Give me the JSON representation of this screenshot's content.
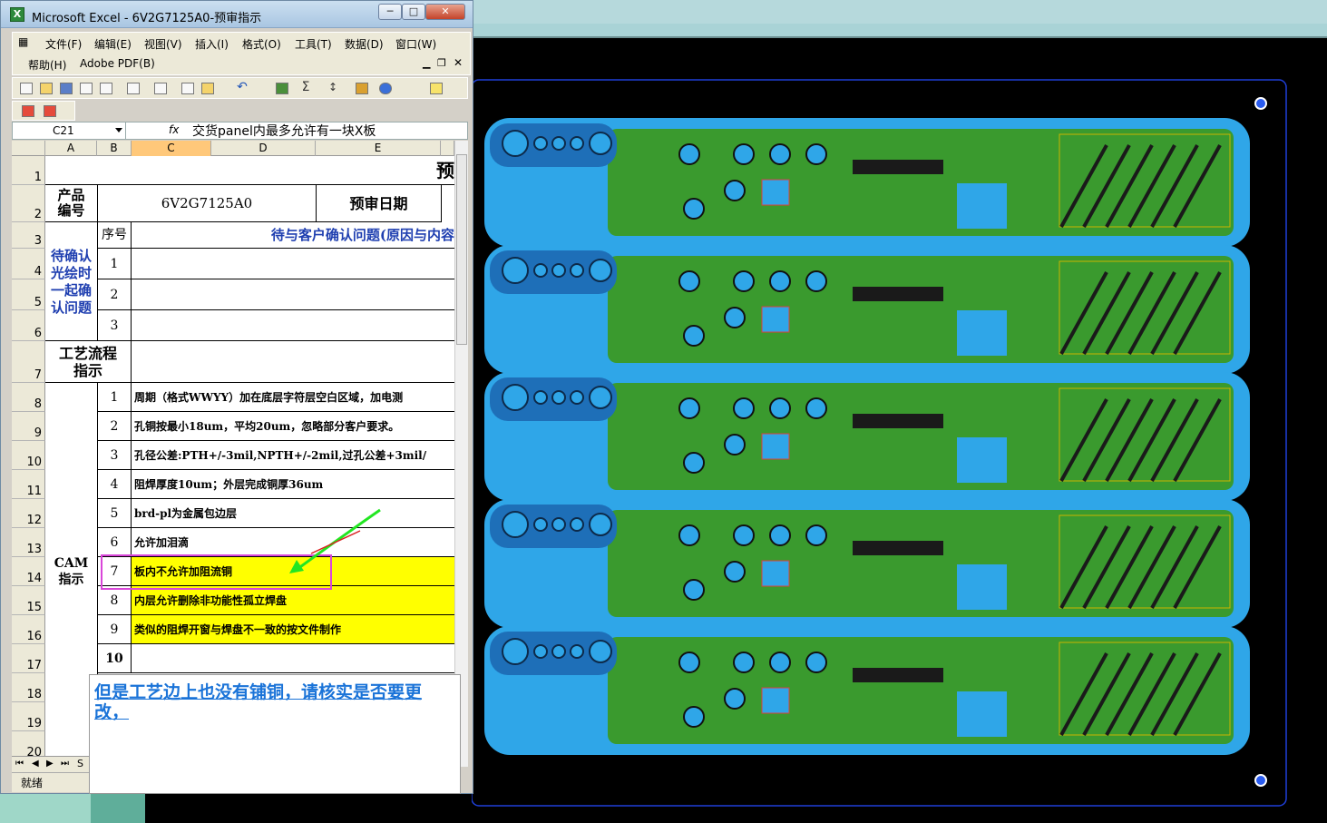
{
  "window": {
    "title": "Microsoft Excel - 6V2G7125A0-预审指示",
    "minimize": "─",
    "maximize": "□",
    "close": "✕"
  },
  "menu": {
    "row1": [
      "文件(F)",
      "编辑(E)",
      "视图(V)",
      "插入(I)",
      "格式(O)",
      "工具(T)",
      "数据(D)",
      "窗口(W)"
    ],
    "row2": [
      "帮助(H)",
      "Adobe PDF(B)"
    ]
  },
  "formula_bar": {
    "name_box": "C21",
    "fx": "fx",
    "content": "交货panel内最多允许有一块X板"
  },
  "columns": [
    "A",
    "B",
    "C",
    "D",
    "E"
  ],
  "rows": [
    "1",
    "2",
    "3",
    "4",
    "5",
    "6",
    "7",
    "8",
    "9",
    "10",
    "11",
    "12",
    "13",
    "14",
    "15",
    "16",
    "17",
    "18",
    "19",
    "20"
  ],
  "sheet": {
    "title_fragment": "预",
    "product_label": "产品\n编号",
    "product_code": "6V2G7125A0",
    "review_date_label": "预审日期",
    "confirm_label": "待确认\n光绘时\n一起确\n认问题",
    "seq_label": "序号",
    "confirm_header": "待与客户确认问题(原因与内容",
    "confirm_items": [
      "1",
      "2",
      "3"
    ],
    "process_label": "工艺流程\n指示",
    "cam_label": "CAM\n指示",
    "cam_items": [
      {
        "no": "1",
        "text": "周期（格式WWYY）加在底层字符层空白区域，加电测"
      },
      {
        "no": "2",
        "text": "孔铜按最小18um，平均20um，忽略部分客户要求。"
      },
      {
        "no": "3",
        "text": "孔径公差:PTH+/-3mil,NPTH+/-2mil,过孔公差+3mil/"
      },
      {
        "no": "4",
        "text": "阻焊厚度10um；外层完成铜厚36um"
      },
      {
        "no": "5",
        "text": "brd-pl为金属包边层"
      },
      {
        "no": "6",
        "text": "允许加泪滴"
      },
      {
        "no": "7",
        "text": "板内不允许加阻流铜"
      },
      {
        "no": "8",
        "text": "内层允许删除非功能性孤立焊盘"
      },
      {
        "no": "9",
        "text": "类似的阻焊开窗与焊盘不一致的按文件制作"
      },
      {
        "no": "10",
        "text": ""
      }
    ]
  },
  "comment": "但是工艺边上也没有铺铜，请核实是否要更改，",
  "sheet_tab": "S",
  "status": "就绪",
  "colors": {
    "pcb_blue": "#2fa6e8",
    "pcb_green": "#3a9a2e",
    "highlight_yellow": "#ffff00",
    "annotation_magenta": "#d946d9",
    "arrow_green": "#22e622"
  }
}
